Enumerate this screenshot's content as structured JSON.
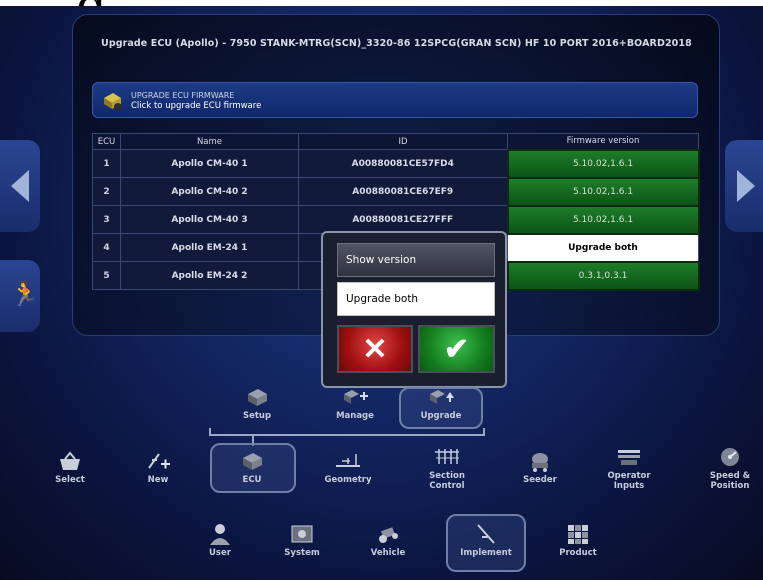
{
  "top_title": {
    "text": "g"
  },
  "upgrade_title": "Upgrade ECU (Apollo) - 7950 STANK-MTRG(SCN)_3320-86 12SPCG(GRAN SCN) HF 10 PORT 2016+BOARD2018",
  "banner": {
    "line1": "UPGRADE ECU FIRMWARE",
    "line2": "Click to upgrade ECU firmware",
    "icon": "ecu-chip-icon"
  },
  "table": {
    "headers": [
      "ECU",
      "Name",
      "ID",
      "Firmware version"
    ],
    "rows": [
      {
        "ecu": "1",
        "name": "Apollo CM-40 1",
        "id": "A00880081CE57FD4",
        "fw": "5.10.02,1.6.1",
        "fw_style": "green"
      },
      {
        "ecu": "2",
        "name": "Apollo CM-40 2",
        "id": "A00880081CE67EF9",
        "fw": "5.10.02,1.6.1",
        "fw_style": "green"
      },
      {
        "ecu": "3",
        "name": "Apollo CM-40 3",
        "id": "A00880081CE27FFF",
        "fw": "5.10.02,1.6.1",
        "fw_style": "green"
      },
      {
        "ecu": "4",
        "name": "Apollo EM-24 1",
        "id": "",
        "fw": "Upgrade both",
        "fw_style": "white"
      },
      {
        "ecu": "5",
        "name": "Apollo EM-24 2",
        "id": "",
        "fw": "0.3.1,0.3.1",
        "fw_style": "green"
      }
    ]
  },
  "popup": {
    "option_show": "Show version",
    "option_upgrade": "Upgrade both",
    "cancel_symbol": "✕",
    "ok_symbol": "✔"
  },
  "side": {
    "left_icon": "arrow-left-icon",
    "right_icon": "arrow-right-icon",
    "run_icon": "running-person-icon",
    "run_glyph": "🏃"
  },
  "sub_nav": {
    "setup": "Setup",
    "manage": "Manage",
    "upgrade": "Upgrade"
  },
  "main_nav": {
    "select": "Select",
    "new": "New",
    "ecu": "ECU",
    "geometry": "Geometry",
    "section_control": "Section\nControl",
    "seeder": "Seeder",
    "operator_inputs": "Operator\nInputs",
    "speed_position": "Speed &\nPosition"
  },
  "bottom_nav": {
    "user": "User",
    "system": "System",
    "vehicle": "Vehicle",
    "implement": "Implement",
    "product": "Product"
  },
  "colors": {
    "fw_green": "#1e7d2a",
    "cancel_red": "#c01818",
    "ok_green": "#1f9a2c"
  }
}
